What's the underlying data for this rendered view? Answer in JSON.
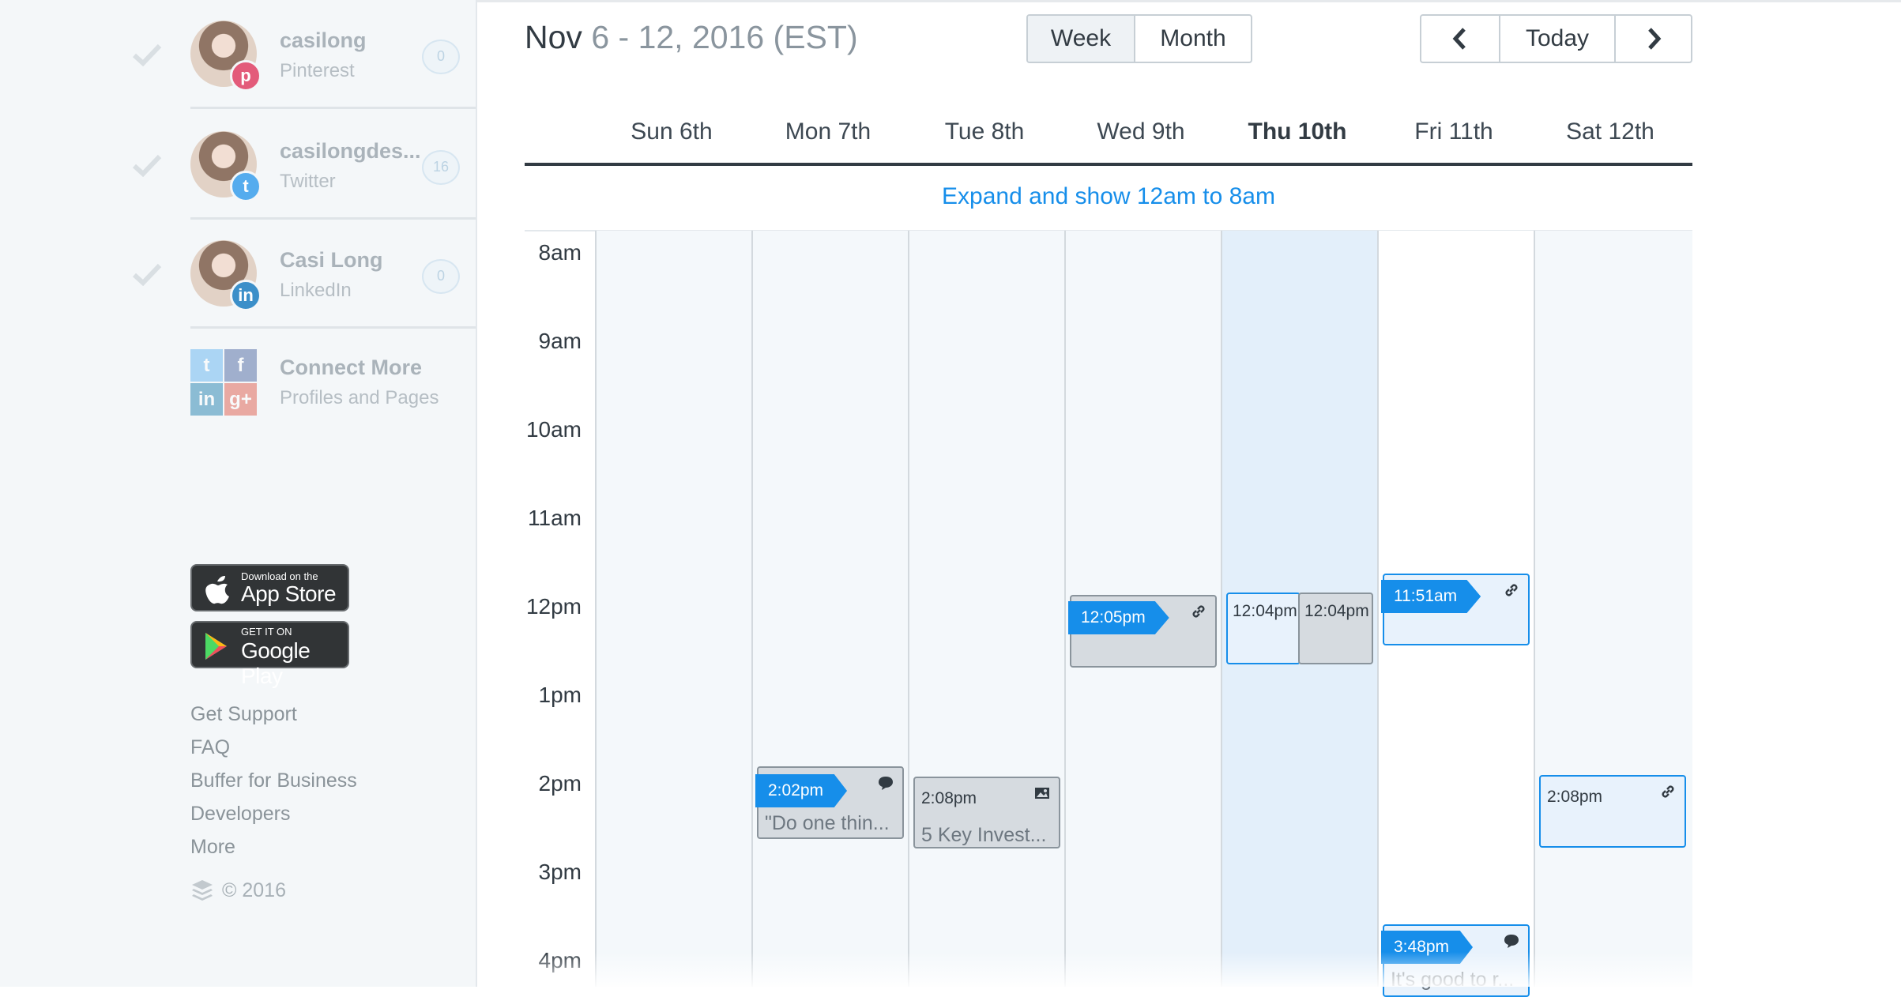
{
  "sidebar": {
    "profiles": [
      {
        "name": "casilong",
        "network": "Pinterest",
        "count": "0",
        "badge": "p",
        "color": "#e35b7a"
      },
      {
        "name": "casilongdes...",
        "network": "Twitter",
        "count": "16",
        "badge": "t",
        "color": "#55acee"
      },
      {
        "name": "Casi Long",
        "network": "LinkedIn",
        "count": "0",
        "badge": "in",
        "color": "#3b8fc9"
      }
    ],
    "connect": {
      "title": "Connect More",
      "subtitle": "Profiles and Pages"
    },
    "app_store": {
      "sub": "Download on the",
      "main": "App Store"
    },
    "google_play": {
      "sub": "GET IT ON",
      "main": "Google Play"
    },
    "footer_links": [
      "Get Support",
      "FAQ",
      "Buffer for Business",
      "Developers",
      "More"
    ],
    "copyright": "© 2016"
  },
  "header": {
    "month": "Nov",
    "range": "6 - 12, 2016 (EST)",
    "views": [
      "Week",
      "Month"
    ],
    "active_view": "Week",
    "today_label": "Today"
  },
  "calendar": {
    "days": [
      "Sun 6th",
      "Mon 7th",
      "Tue 8th",
      "Wed 9th",
      "Thu 10th",
      "Fri 11th",
      "Sat 12th"
    ],
    "today": "Thu 10th",
    "expand_label": "Expand and show 12am to 8am",
    "hours": [
      "8am",
      "9am",
      "10am",
      "11am",
      "12pm",
      "1pm",
      "2pm",
      "3pm",
      "4pm"
    ]
  },
  "posts": [
    {
      "time": "2:02pm",
      "text": "\"Do one thin...",
      "icon": "comment-icon"
    },
    {
      "time": "2:08pm",
      "text": "5 Key Invest...",
      "icon": "image-icon"
    },
    {
      "time": "12:05pm",
      "text": "",
      "icon": "link-icon"
    },
    {
      "time": "12:04pm",
      "text": ""
    },
    {
      "time": "12:04pm",
      "text": ""
    },
    {
      "time": "11:51am",
      "text": "",
      "icon": "link-icon"
    },
    {
      "time": "3:48pm",
      "text": "It's good to r...",
      "icon": "comment-icon"
    },
    {
      "time": "2:08pm",
      "text": "",
      "icon": "link-icon"
    }
  ],
  "colors": {
    "accent": "#168eea",
    "today_column": "#e3effa",
    "sent_post": "#d6dbe0"
  }
}
